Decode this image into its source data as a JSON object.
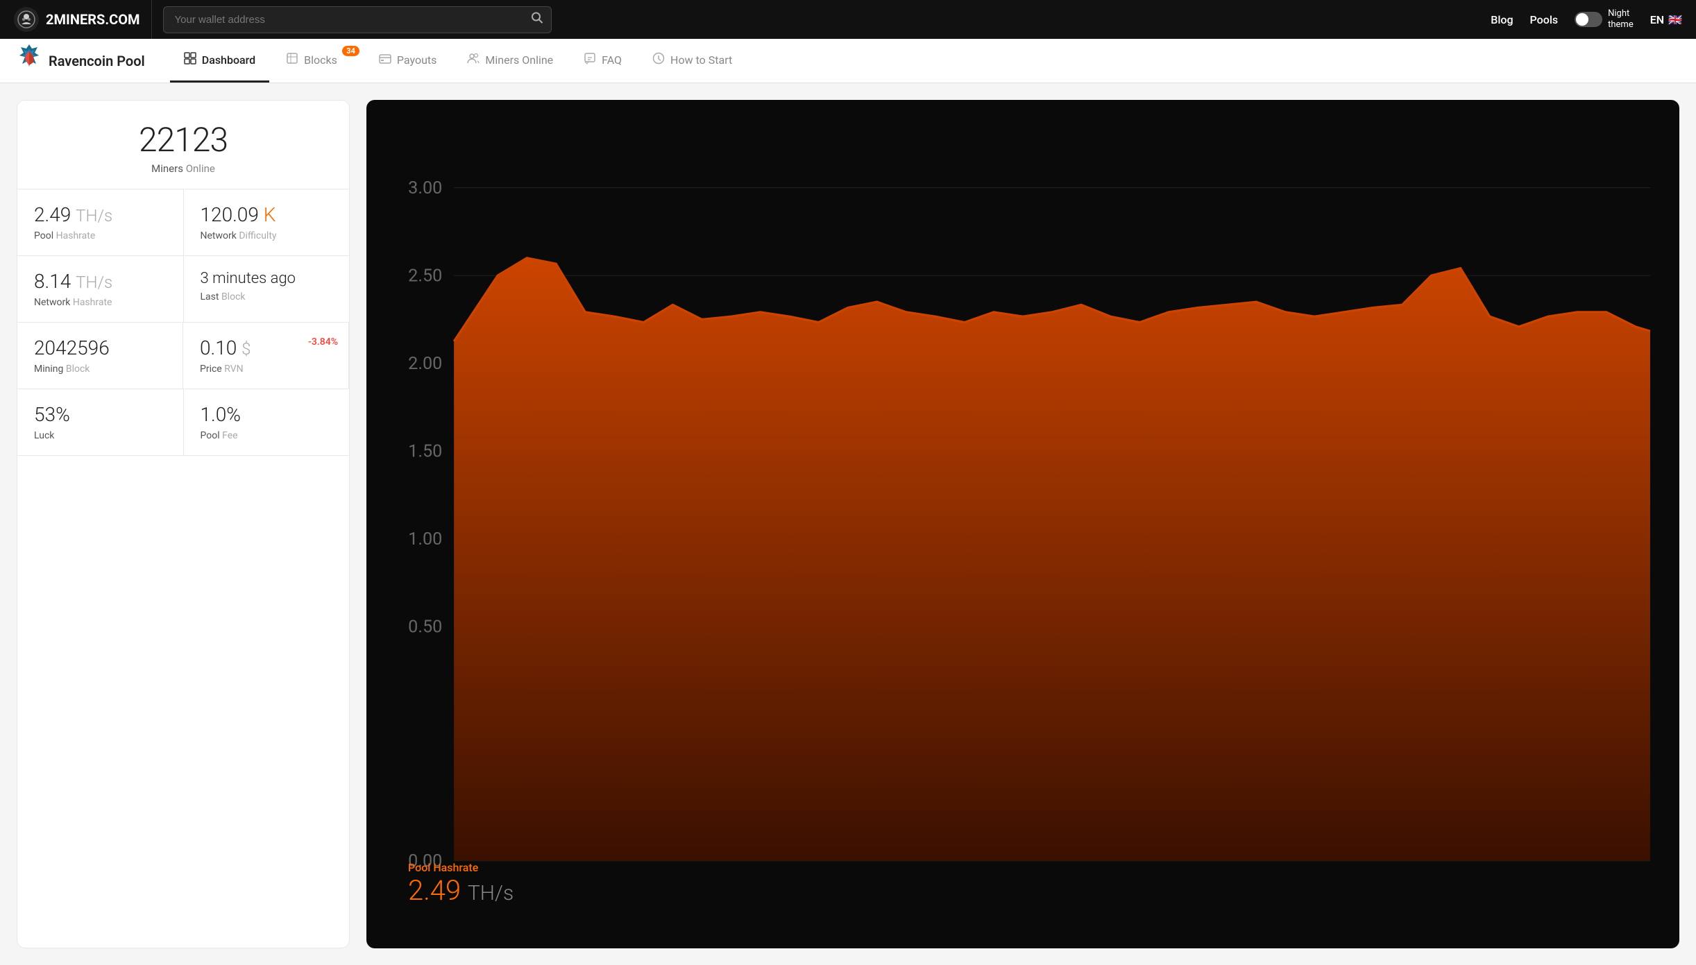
{
  "topnav": {
    "logo_text": "2MINERS.COM",
    "logo_icon": "⚙",
    "search_placeholder": "Your wallet address",
    "blog_label": "Blog",
    "pools_label": "Pools",
    "night_theme_label": "Night\ntheme",
    "lang_label": "EN",
    "flag": "🇬🇧"
  },
  "subnav": {
    "pool_name": "Ravencoin Pool",
    "tabs": [
      {
        "label": "Dashboard",
        "icon": "🏠",
        "active": true,
        "badge": null
      },
      {
        "label": "Blocks",
        "icon": "📦",
        "active": false,
        "badge": "34"
      },
      {
        "label": "Payouts",
        "icon": "💳",
        "active": false,
        "badge": null
      },
      {
        "label": "Miners Online",
        "icon": "👥",
        "active": false,
        "badge": null
      },
      {
        "label": "FAQ",
        "icon": "💬",
        "active": false,
        "badge": null
      },
      {
        "label": "How to Start",
        "icon": "❓",
        "active": false,
        "badge": null
      }
    ]
  },
  "stats": {
    "miners_count": "22123",
    "miners_label": "Miners",
    "miners_online": "Online",
    "pool_hashrate_value": "2.49",
    "pool_hashrate_unit": "TH/s",
    "pool_hashrate_label": "Pool",
    "pool_hashrate_label2": "Hashrate",
    "network_difficulty_value": "120.09",
    "network_difficulty_unit": "K",
    "network_difficulty_label": "Network",
    "network_difficulty_label2": "Difficulty",
    "network_hashrate_value": "8.14",
    "network_hashrate_unit": "TH/s",
    "network_hashrate_label": "Network",
    "network_hashrate_label2": "Hashrate",
    "last_block_value": "3 minutes ago",
    "last_block_label": "Last",
    "last_block_label2": "Block",
    "mining_block_value": "2042596",
    "mining_block_label": "Mining",
    "mining_block_label2": "Block",
    "price_value": "0.10",
    "price_unit": "$",
    "price_label": "Price",
    "price_label2": "RVN",
    "price_change": "-3.84%",
    "luck_value": "53%",
    "luck_label": "Luck",
    "pool_fee_value": "1.0%",
    "pool_fee_label": "Pool",
    "pool_fee_label2": "Fee"
  },
  "chart": {
    "hashrate_label": "Pool Hashrate",
    "hashrate_value": "2.49",
    "hashrate_unit": "TH/s",
    "y_labels": [
      "3.00",
      "2.50",
      "2.00",
      "1.50",
      "1.00",
      "0.50",
      "0.00"
    ]
  }
}
